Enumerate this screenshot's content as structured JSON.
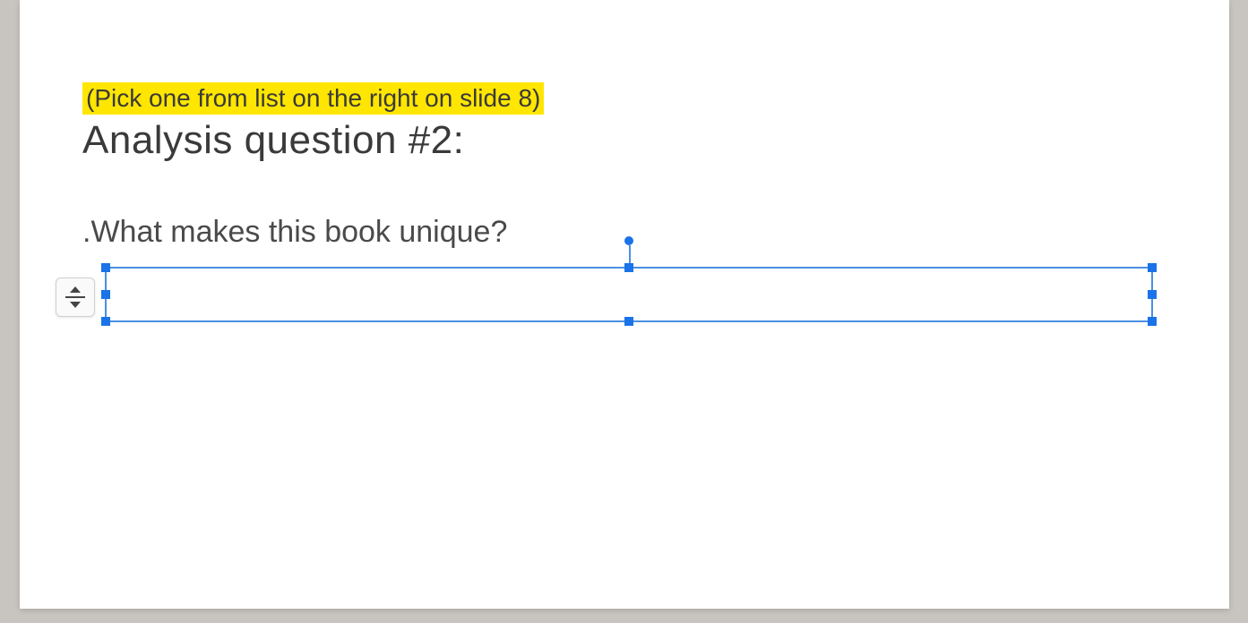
{
  "slide": {
    "instruction": "(Pick one from list on the right on slide 8)",
    "heading": "Analysis question #2:",
    "body": ".What makes this book unique?"
  }
}
